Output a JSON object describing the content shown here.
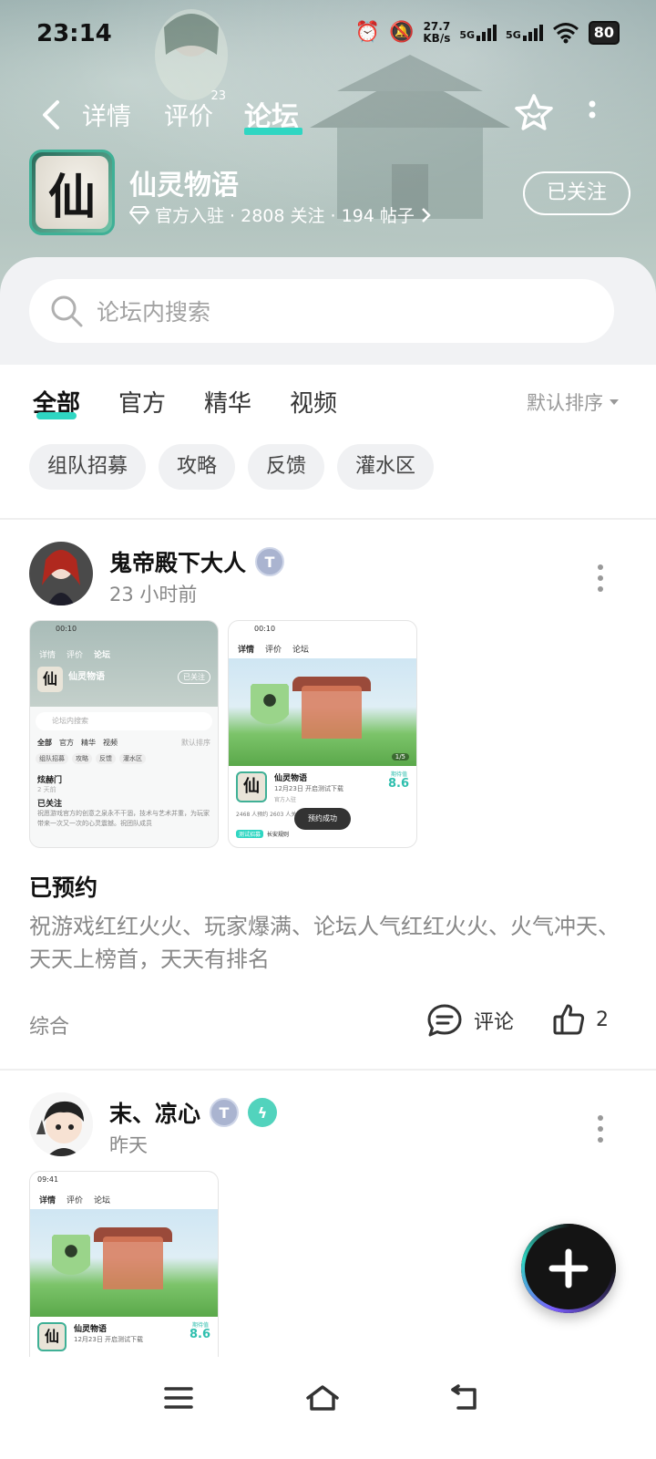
{
  "status_bar": {
    "time": "23:14",
    "speed_value": "27.7",
    "speed_unit": "KB/s",
    "signal_1": "5G",
    "signal_2": "5G",
    "battery": "80"
  },
  "top_nav": {
    "tabs": [
      {
        "label": "详情"
      },
      {
        "label": "评价",
        "superscript": "23"
      },
      {
        "label": "论坛",
        "active": true
      }
    ]
  },
  "game": {
    "logo_char": "仙",
    "name": "仙灵物语",
    "meta": "官方入驻 · 2808 关注 · 194 帖子",
    "follow_label": "已关注"
  },
  "search": {
    "placeholder": "论坛内搜索"
  },
  "filter_tabs": [
    {
      "label": "全部",
      "active": true
    },
    {
      "label": "官方"
    },
    {
      "label": "精华"
    },
    {
      "label": "视频"
    }
  ],
  "sort_label": "默认排序",
  "chips": [
    "组队招募",
    "攻略",
    "反馈",
    "灌水区"
  ],
  "posts": [
    {
      "author": "鬼帝殿下大人",
      "time": "23 小时前",
      "title": "已预约",
      "text": "祝游戏红红火火、玩家爆满、论坛人气红红火火、火气冲天、天天上榜首，天天有排名",
      "category": "综合",
      "comment_label": "评论",
      "like_count": "2",
      "thumbs": [
        {
          "status_time": "00:10",
          "tabs": [
            "详情",
            "评价",
            "论坛"
          ],
          "game_name": "仙灵物语",
          "follow": "已关注",
          "search": "论坛内搜索",
          "filters": [
            "全部",
            "官方",
            "精华",
            "视频"
          ],
          "sort": "默认排序",
          "chips": [
            "组队招募",
            "攻略",
            "反馈",
            "灌水区"
          ],
          "poster": "炫赫门",
          "poster_time": "2 天前",
          "post_title": "已关注",
          "post_text": "祝愿游戏官方的创意之泉永不干涸，技术与艺术并重，为玩家带来一次又一次的心灵震撼。祝团队成员"
        },
        {
          "status_time": "00:10",
          "tabs": [
            "详情",
            "评价",
            "论坛"
          ],
          "page": "1/5",
          "game_name": "仙灵物语",
          "game_sub": "12月23日 开启测试下载",
          "official": "官方入驻",
          "score_label": "期待值",
          "score": "8.6",
          "stats": "2468 人预约    2603 人关注",
          "toast": "预约成功",
          "tag": "测试招募",
          "tag_text": "长安规则"
        }
      ]
    },
    {
      "author": "末、凉心",
      "time": "昨天",
      "thumbs": [
        {
          "status_time": "09:41",
          "tabs": [
            "详情",
            "评价",
            "论坛"
          ],
          "game_name": "仙灵物语",
          "game_sub": "12月23日 开启测试下载",
          "score_label": "期待值",
          "score": "8.6"
        }
      ]
    }
  ],
  "colors": {
    "accent": "#2fd6c2",
    "text_primary": "#111111",
    "text_secondary": "#888888"
  }
}
